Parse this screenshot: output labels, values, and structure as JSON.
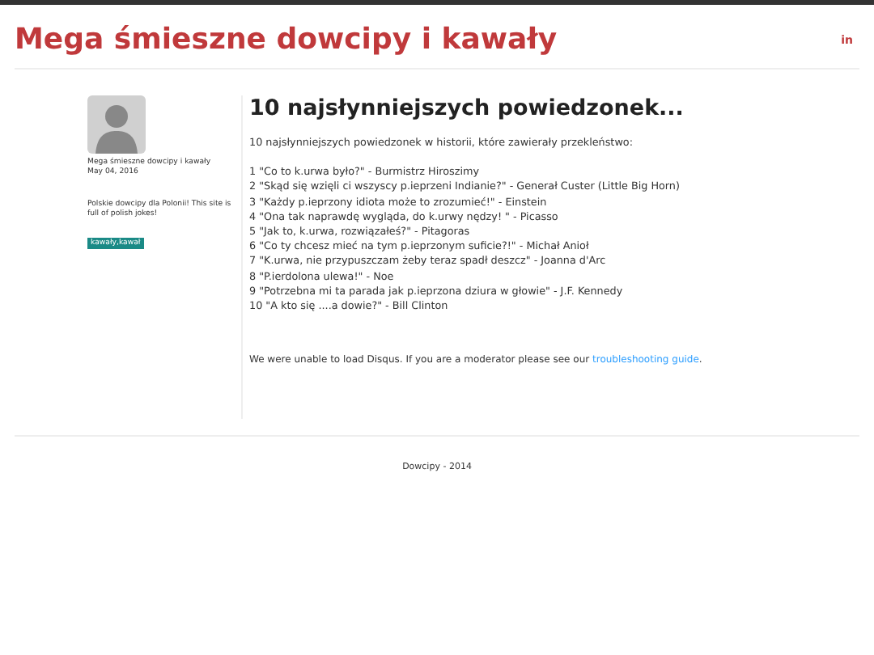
{
  "header": {
    "title": "Mega śmieszne dowcipy i kawały",
    "social_link": "in"
  },
  "sidebar": {
    "blog_name": "Mega śmieszne dowcipy i kawały",
    "date": "May 04, 2016",
    "description": "Polskie dowcipy dla Polonii! This site is full of polish jokes!",
    "tags": [
      "kawały,kawał"
    ]
  },
  "post": {
    "title": "10 najsłynniejszych powiedzonek...",
    "intro": "10 najsłynniejszych powiedzonek w historii, które zawierały przekleństwo:",
    "lines": [
      "1 \"Co to k.urwa było?\" - Burmistrz Hiroszimy",
      "2 \"Skąd się wzięli ci wszyscy p.ieprzeni Indianie?\" - Generał Custer (Little Big Horn)",
      "3 \"Każdy p.ieprzony idiota może to zrozumieć!\" - Einstein",
      "4 \"Ona tak naprawdę wygląda, do k.urwy nędzy! \" - Picasso",
      "5 \"Jak to, k.urwa, rozwiązałeś?\" - Pitagoras",
      "6 \"Co ty chcesz mieć na tym p.ieprzonym suficie?!\" - Michał Anioł",
      "7 \"K.urwa, nie przypuszczam żeby teraz spadł deszcz\" - Joanna d'Arc",
      "8 \"P.ierdolona ulewa!\" - Noe",
      "9 \"Potrzebna mi ta parada jak p.ieprzona dziura w głowie\" - J.F. Kennedy",
      "10 \"A kto się ....a dowie?\" - Bill Clinton"
    ]
  },
  "comments": {
    "message_before": "We were unable to load Disqus. If you are a moderator please see our ",
    "link": "troubleshooting guide",
    "message_after": "."
  },
  "footer": {
    "text": "Dowcipy - 2014"
  }
}
